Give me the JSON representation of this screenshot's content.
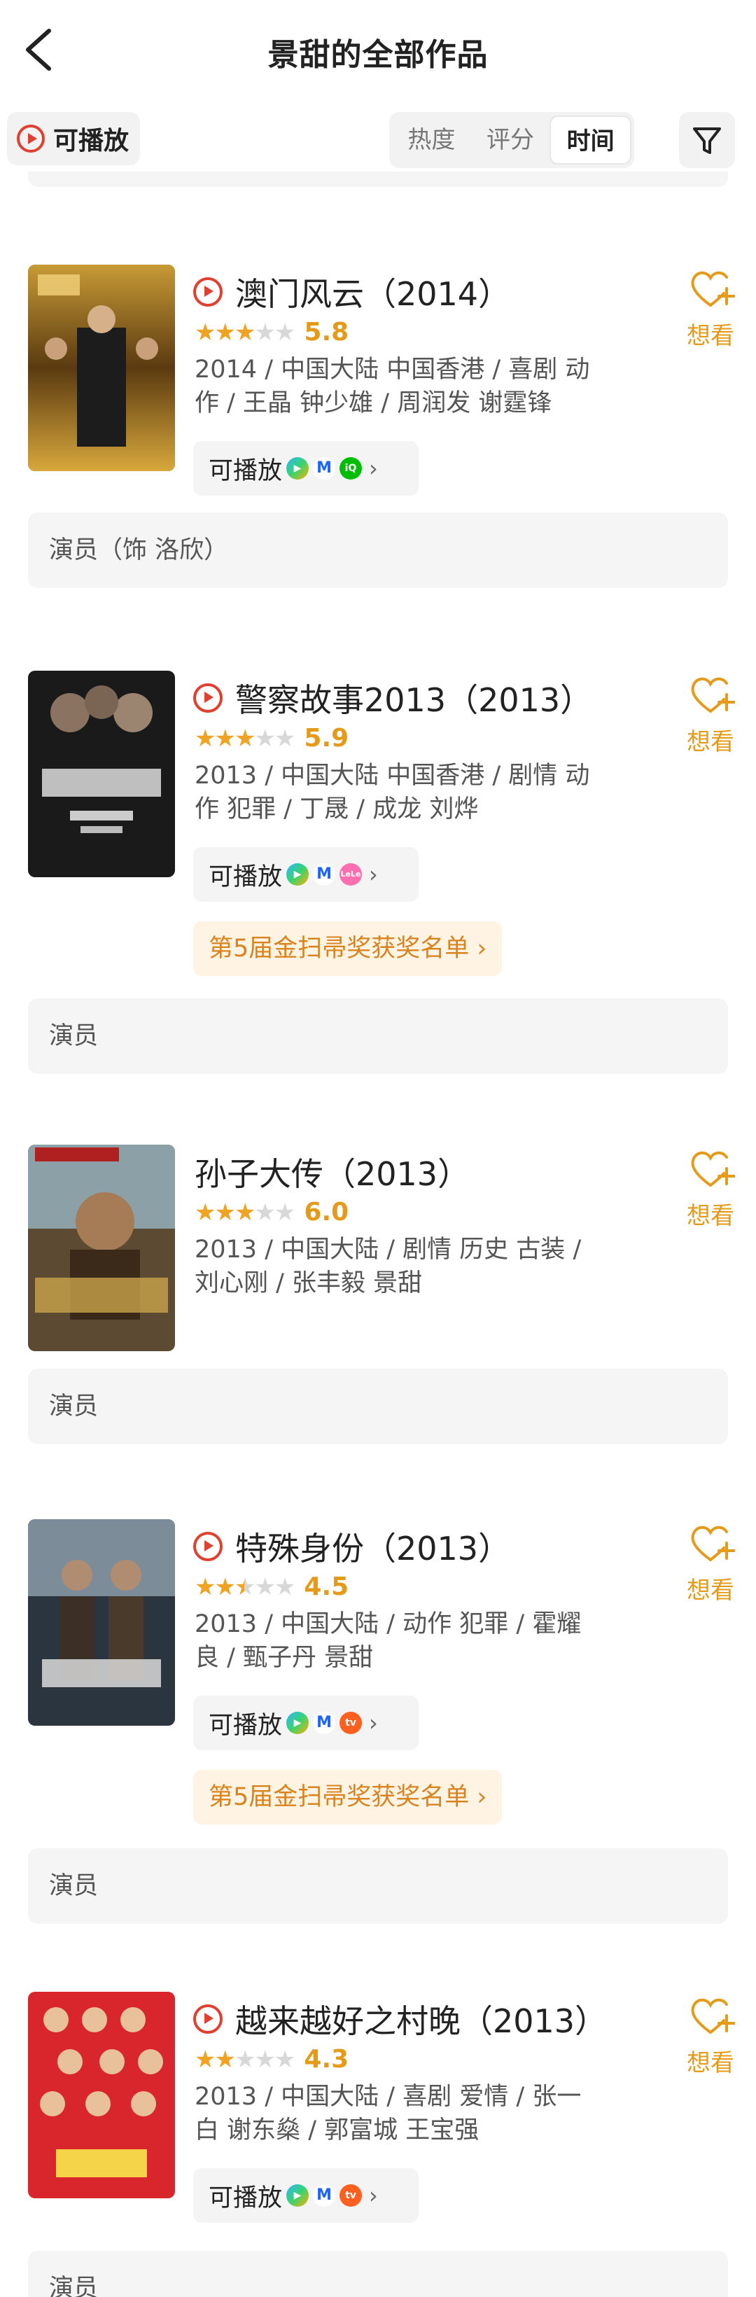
{
  "page": {
    "title": "景甜的全部作品"
  },
  "filters": {
    "playable_label": "可播放",
    "sort_tabs": [
      "热度",
      "评分",
      "时间"
    ],
    "active_sort": "时间"
  },
  "movies": [
    {
      "title": "澳门风云（2014）",
      "playable": true,
      "stars": 3,
      "score": "5.8",
      "meta": "2014 / 中国大陆 中国香港 / 喜剧 动作 / 王晶 钟少雄 / 周润发 谢霆锋",
      "stream_label": "可播放",
      "platforms": [
        "tencent-video",
        "youku",
        "iqiyi"
      ],
      "award": null,
      "role": "演员（饰 洛欣）",
      "want_label": "想看"
    },
    {
      "title": "警察故事2013（2013）",
      "playable": true,
      "stars": 3,
      "score": "5.9",
      "meta": "2013 / 中国大陆 中国香港 / 剧情 动作 犯罪 / 丁晟 / 成龙 刘烨",
      "stream_label": "可播放",
      "platforms": [
        "tencent-video",
        "youku",
        "leshi"
      ],
      "award": "第5届金扫帚奖获奖名单",
      "role": "演员",
      "want_label": "想看"
    },
    {
      "title": "孙子大传（2013）",
      "playable": false,
      "stars": 3,
      "score": "6.0",
      "meta": "2013 / 中国大陆 / 剧情 历史 古装 / 刘心刚 / 张丰毅 景甜",
      "stream_label": null,
      "platforms": [],
      "award": null,
      "role": "演员",
      "want_label": "想看"
    },
    {
      "title": "特殊身份（2013）",
      "playable": true,
      "stars": 2.5,
      "score": "4.5",
      "meta": "2013 / 中国大陆 / 动作 犯罪 / 霍耀良 / 甄子丹 景甜",
      "stream_label": "可播放",
      "platforms": [
        "tencent-video",
        "youku",
        "mgtv"
      ],
      "award": "第5届金扫帚奖获奖名单",
      "role": "演员",
      "want_label": "想看"
    },
    {
      "title": "越来越好之村晚（2013）",
      "playable": true,
      "stars": 2,
      "score": "4.3",
      "meta": "2013 / 中国大陆 / 喜剧 爱情 / 张一白 谢东燊 / 郭富城 王宝强",
      "stream_label": "可播放",
      "platforms": [
        "tencent-video",
        "youku",
        "mgtv"
      ],
      "award": null,
      "role": "演员",
      "want_label": "想看"
    }
  ],
  "colors": {
    "accent": "#e59b1a",
    "play_red": "#e0402f",
    "award_bg": "#fff4e3"
  }
}
